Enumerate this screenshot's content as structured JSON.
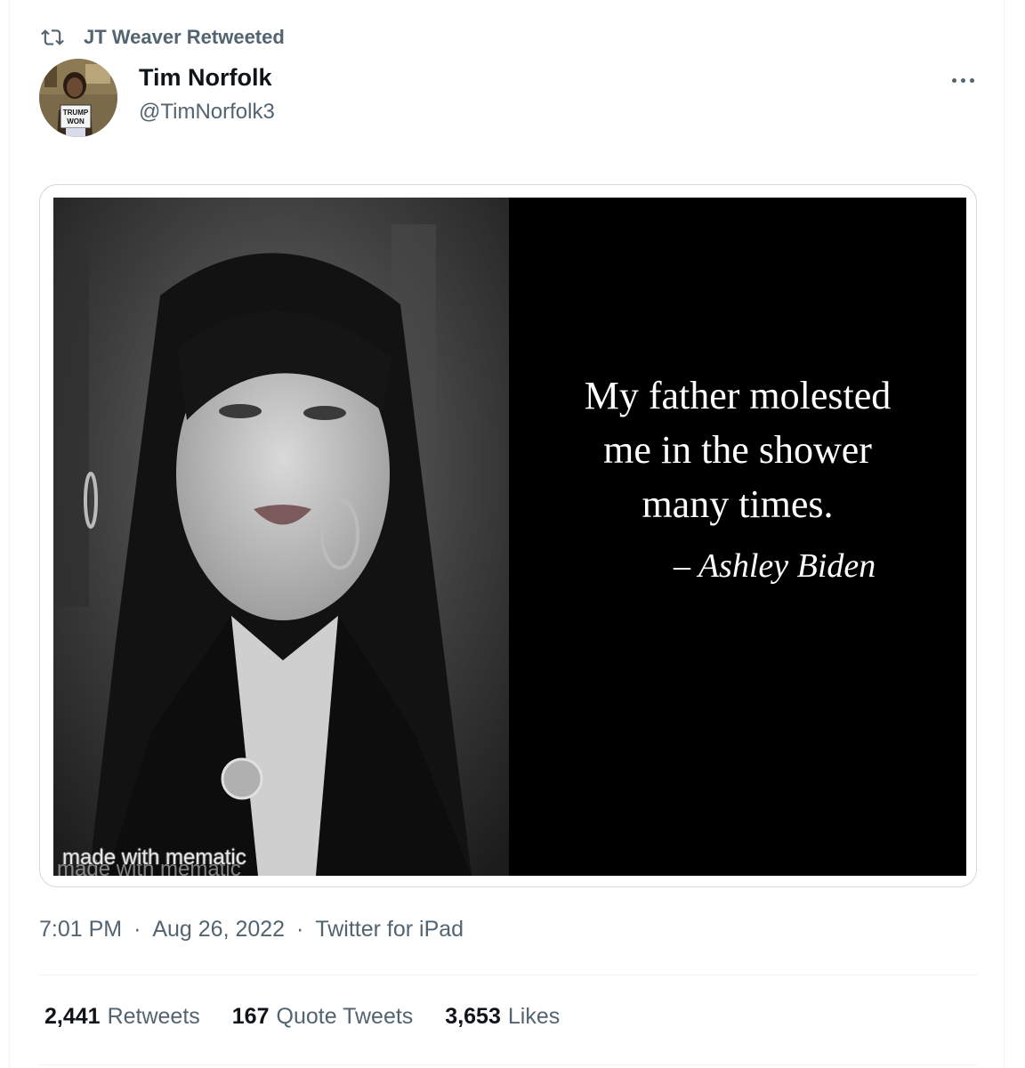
{
  "retweet_banner": {
    "text": "JT Weaver Retweeted",
    "icon": "retweet-icon"
  },
  "author": {
    "name": "Tim Norfolk",
    "handle": "@TimNorfolk3",
    "avatar_sign_text": [
      "TRUMP",
      "WON"
    ]
  },
  "more_menu": {
    "icon": "ellipsis-icon"
  },
  "media": {
    "quote_lines": [
      "My father molested",
      "me in the shower",
      "many times."
    ],
    "attribution": "– Ashley Biden",
    "watermark": "made with mematic"
  },
  "meta": {
    "time": "7:01 PM",
    "separator": "·",
    "date": "Aug 26, 2022",
    "source": "Twitter for iPad"
  },
  "stats": [
    {
      "count": "2,441",
      "label": "Retweets"
    },
    {
      "count": "167",
      "label": "Quote Tweets"
    },
    {
      "count": "3,653",
      "label": "Likes"
    }
  ],
  "colors": {
    "primary_text": "#0f1419",
    "secondary_text": "#536471",
    "border": "#cfd9de",
    "divider": "#eff3f4"
  }
}
